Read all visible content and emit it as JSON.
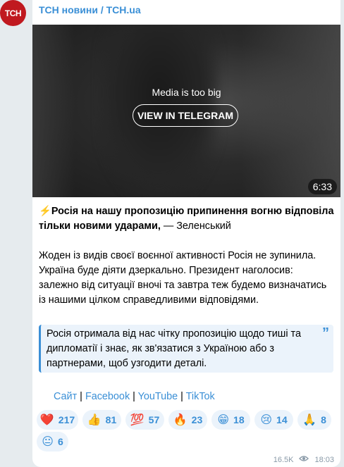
{
  "channel": {
    "name": "ТСН новини / TCH.ua",
    "avatar_text": "TCH"
  },
  "media": {
    "notice": "Media is too big",
    "button_label": "VIEW IN TELEGRAM",
    "duration": "6:33"
  },
  "post": {
    "headline_bold": "⚡️Росія на нашу пропозицію припинення вогню відповіла тільки новими ударами,",
    "headline_tail": " — Зеленський",
    "body": "Жоден із видів своєї воєнної активності Росія не зупинила. Україна буде діяти дзеркально. Президент наголосив: залежно від ситуації вночі та завтра теж будемо визначатись із нашими цілком справедливими відповідями.",
    "quote": "Росія отримала від нас чітку пропозицію щодо тиші та дипломатії і знає, як зв'язатися з Україною або з партнерами, щоб узгодити деталі."
  },
  "links": [
    {
      "label": "Сайт"
    },
    {
      "label": "Facebook"
    },
    {
      "label": "YouTube"
    },
    {
      "label": "TikTok"
    }
  ],
  "link_separator": " | ",
  "reactions": [
    {
      "emoji": "❤️",
      "count": "217"
    },
    {
      "emoji": "👍",
      "count": "81"
    },
    {
      "emoji": "💯",
      "count": "57"
    },
    {
      "emoji": "🔥",
      "count": "23"
    },
    {
      "emoji": "😁",
      "count": "18"
    },
    {
      "emoji": "😢",
      "count": "14"
    },
    {
      "emoji": "🙏",
      "count": "8"
    },
    {
      "emoji": "😐",
      "count": "6"
    }
  ],
  "meta": {
    "views": "16.5K",
    "time": "18:03"
  },
  "colors": {
    "accent": "#3a8fd6",
    "avatar": "#c0191f",
    "background": "#e6ebee"
  }
}
